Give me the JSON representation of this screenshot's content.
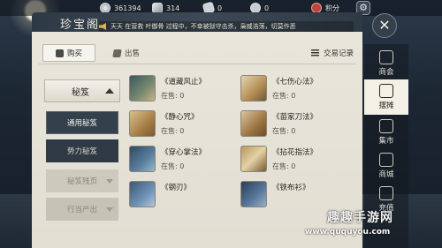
{
  "resources": {
    "silver": "361394",
    "ingot": "314",
    "ticket": "0",
    "coupon": "0",
    "points_label": "积分"
  },
  "panel": {
    "title": "珍宝阁",
    "ticker": "天天 在营救 叶御骨 过程中，不幸被狱守击杀，枭威浩荡，切莫作恶"
  },
  "tabs": {
    "buy": "购买",
    "sell": "出售",
    "trade_records": "交易记录"
  },
  "categories": {
    "header": "秘笈",
    "items": [
      {
        "label": "通用秘笈"
      },
      {
        "label": "势力秘笈"
      },
      {
        "label": "秘笈残页"
      },
      {
        "label": "行当产出"
      }
    ]
  },
  "items": [
    {
      "name": "《道藏风止》",
      "sale": "在售: 0"
    },
    {
      "name": "《七伤心法》",
      "sale": "在售: 0"
    },
    {
      "name": "《静心咒》",
      "sale": "在售: 0"
    },
    {
      "name": "《苗家刀法》",
      "sale": "在售: 0"
    },
    {
      "name": "《穿心掌法》",
      "sale": "在售: 0"
    },
    {
      "name": "《拈花指法》",
      "sale": "在售: 0"
    },
    {
      "name": "《钢刃》",
      "sale": ""
    },
    {
      "name": "《铁布衫》",
      "sale": ""
    }
  ],
  "right_nav": [
    {
      "label": "商会"
    },
    {
      "label": "摆摊"
    },
    {
      "label": "集市"
    },
    {
      "label": "商城"
    },
    {
      "label": "充值"
    }
  ],
  "watermark": {
    "title": "趣趣手游网",
    "url": "www.ququyou.com"
  }
}
